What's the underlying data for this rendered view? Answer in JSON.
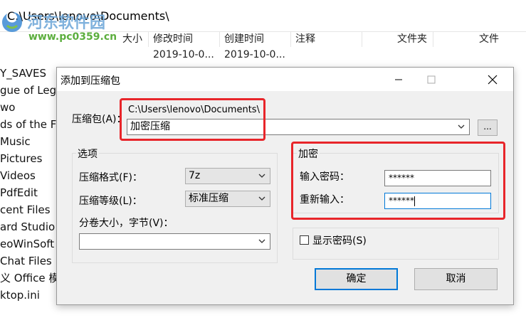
{
  "explorer": {
    "path": "C:\\Users\\lenovo\\Documents\\",
    "watermark_cn": "河东软件园",
    "watermark_url": "www.pc0359.cn",
    "columns": [
      "大小",
      "修改时间",
      "创建时间",
      "注释",
      "文件夹",
      "文件"
    ],
    "dates": [
      "2019-10-0...",
      "2019-10-0..."
    ],
    "tree_items": [
      "Y_SAVES",
      "gue of Leg",
      "wo",
      "ds of the Fa",
      "Music",
      "Pictures",
      "Videos",
      "PdfEdit",
      "cent Files",
      "ard Studio",
      "eoWinSoft",
      "Chat Files",
      "义 Office 模",
      "ktop.ini"
    ]
  },
  "dialog": {
    "title": "添加到压缩包",
    "archive_label": "压缩包(A)：",
    "archive_dir": "C:\\Users\\lenovo\\Documents\\",
    "archive_name": "加密压缩",
    "browse_label": "...",
    "options": {
      "title": "选项",
      "format_label": "压缩格式(F)：",
      "format_value": "7z",
      "level_label": "压缩等级(L)：",
      "level_value": "标准压缩",
      "volume_label": "分卷大小，字节(V)：",
      "volume_value": ""
    },
    "encryption": {
      "title": "加密",
      "password_label": "输入密码：",
      "password_value": "******",
      "reenter_label": "重新输入：",
      "reenter_value": "******"
    },
    "show_password_label": "显示密码(S)",
    "show_password_checked": false,
    "ok_label": "确定",
    "cancel_label": "取消"
  },
  "colors": {
    "highlight": "#e8252a",
    "accent": "#0078d7"
  }
}
